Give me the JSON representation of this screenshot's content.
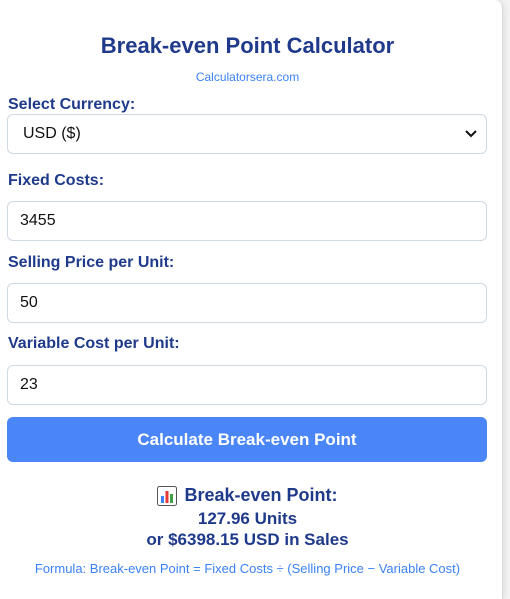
{
  "header": {
    "title": "Break-even Point Calculator",
    "site": "Calculatorsera.com"
  },
  "form": {
    "currency_label": "Select Currency:",
    "currency_value": "USD ($)",
    "fixed_label": "Fixed Costs:",
    "fixed_value": "3455",
    "price_label": "Selling Price per Unit:",
    "price_value": "50",
    "variable_label": "Variable Cost per Unit:",
    "variable_value": "23",
    "button_label": "Calculate Break-even Point"
  },
  "result": {
    "heading": "Break-even Point:",
    "icon": "bar-chart-icon",
    "units_line": "127.96 Units",
    "sales_line": "or $6398.15 USD in Sales",
    "formula": "Formula: Break-even Point = Fixed Costs ÷ (Selling Price − Variable Cost)"
  },
  "colors": {
    "heading": "#1f3a8a",
    "accent": "#3b82f6",
    "button": "#4a86f7"
  }
}
